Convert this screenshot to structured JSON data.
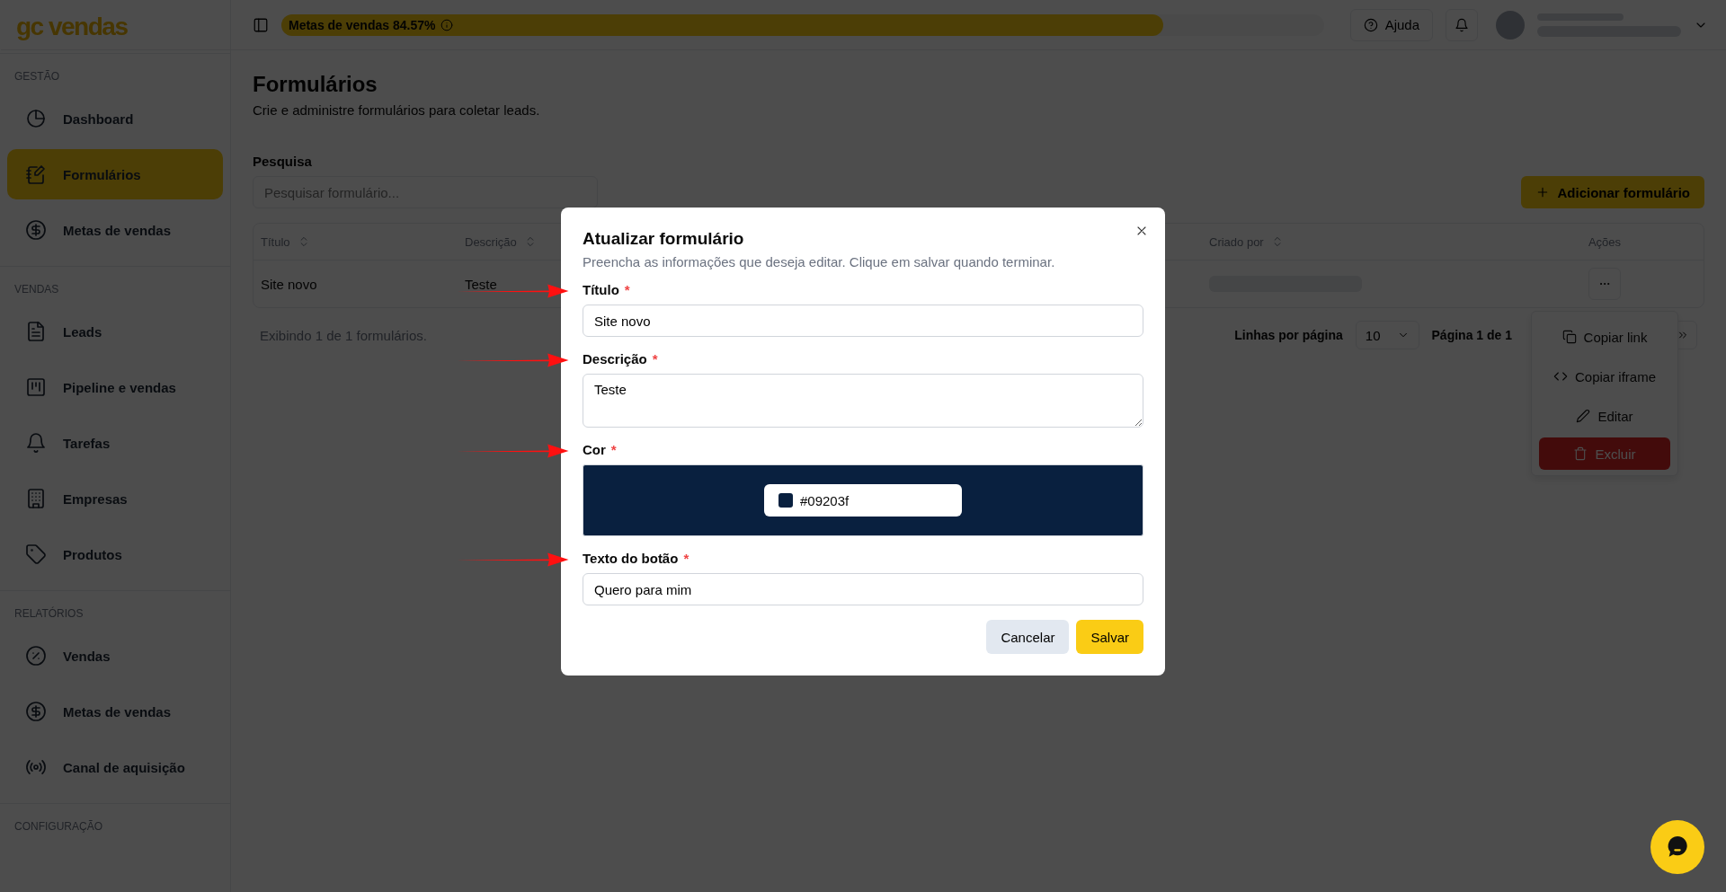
{
  "sidebar": {
    "logo": "gc vendas",
    "sections": [
      {
        "title": "GESTÃO",
        "items": [
          {
            "label": "Dashboard",
            "selected": false
          },
          {
            "label": "Formulários",
            "selected": true
          },
          {
            "label": "Metas de vendas",
            "selected": false
          }
        ]
      },
      {
        "title": "VENDAS",
        "items": [
          {
            "label": "Leads",
            "selected": false
          },
          {
            "label": "Pipeline e vendas",
            "selected": false
          },
          {
            "label": "Tarefas",
            "selected": false
          },
          {
            "label": "Empresas",
            "selected": false
          },
          {
            "label": "Produtos",
            "selected": false
          }
        ]
      },
      {
        "title": "RELATÓRIOS",
        "items": [
          {
            "label": "Vendas",
            "selected": false
          },
          {
            "label": "Metas de vendas",
            "selected": false
          },
          {
            "label": "Canal de aquisição",
            "selected": false
          }
        ]
      },
      {
        "title": "CONFIGURAÇÃO"
      }
    ]
  },
  "topbar": {
    "goal": {
      "label": "Metas de vendas 84.57%",
      "level": 0.8457
    },
    "help_button": "Ajuda"
  },
  "page": {
    "title": "Formulários",
    "subtitle": "Crie e administre formulários para coletar leads."
  },
  "search": {
    "label": "Pesquisa",
    "placeholder": "Pesquisar formulário..."
  },
  "add_button": "Adicionar formulário",
  "table": {
    "columns": [
      {
        "label": "Título",
        "sortable": true
      },
      {
        "label": "Descrição",
        "sortable": true
      },
      {
        "label": "Criado por",
        "sortable": true
      },
      {
        "label": "Ações",
        "sortable": false
      }
    ],
    "rows": [
      {
        "cells": [
          "Site novo",
          "Teste"
        ]
      }
    ]
  },
  "footer": {
    "summary": "Exibindo 1 de 1 formulários.",
    "rows_per_page_label": "Linhas por página",
    "rows_per_page": "10",
    "page_info": "Página 1 de 1"
  },
  "row_menu": {
    "items": [
      {
        "label": "Copiar link",
        "kind": "copy"
      },
      {
        "label": "Copiar iframe",
        "kind": "code"
      },
      {
        "label": "Editar",
        "kind": "edit"
      },
      {
        "label": "Excluir",
        "kind": "delete"
      }
    ]
  },
  "dialog": {
    "title": "Atualizar formulário",
    "description": "Preencha as informações que deseja editar. Clique em salvar quando terminar.",
    "fields": [
      {
        "label": "Título",
        "required_mark": "*",
        "kind": "text",
        "value": "Site novo"
      },
      {
        "label": "Descrição",
        "required_mark": "*",
        "kind": "textarea",
        "value": "Teste"
      },
      {
        "label": "Cor",
        "required_mark": "*",
        "kind": "color",
        "value": "#09203f"
      },
      {
        "label": "Texto do botão",
        "required_mark": "*",
        "kind": "text",
        "value": "Quero para mim"
      }
    ],
    "buttons": [
      {
        "label": "Cancelar",
        "kind": "secondary"
      },
      {
        "label": "Salvar",
        "kind": "primary"
      }
    ]
  }
}
